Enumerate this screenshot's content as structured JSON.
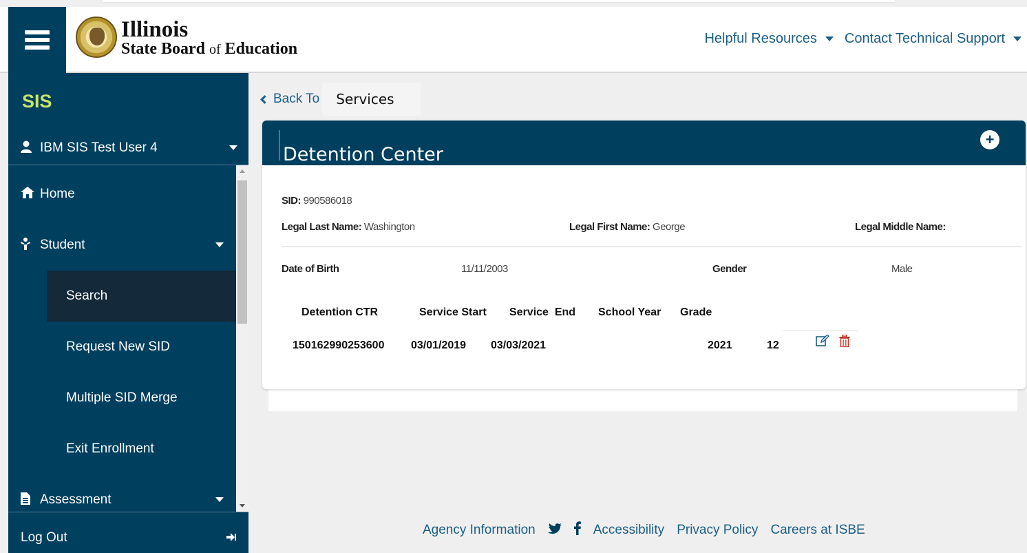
{
  "header": {
    "brand_line1": "Illinois",
    "brand_line2_a": "State Board",
    "brand_line2_of": "of",
    "brand_line2_b": "Education",
    "nav": [
      {
        "label": "Helpful Resources"
      },
      {
        "label": "Contact Technical Support"
      }
    ]
  },
  "sidebar": {
    "app_title": "SIS",
    "user_name": "IBM SIS Test User 4",
    "items": [
      {
        "label": "Home",
        "icon": "home-icon"
      },
      {
        "label": "Student",
        "icon": "student-icon"
      },
      {
        "label": "Search"
      },
      {
        "label": "Request New SID"
      },
      {
        "label": "Multiple SID Merge"
      },
      {
        "label": "Exit Enrollment"
      },
      {
        "label": "Assessment",
        "icon": "document-icon"
      }
    ],
    "logout_label": "Log Out"
  },
  "back": {
    "label": "Back To",
    "target": "Services"
  },
  "card": {
    "title": "Detention Center",
    "sid_label": "SID:",
    "sid_value": "990586018",
    "last_name_label": "Legal Last Name:",
    "last_name_value": "Washington",
    "first_name_label": "Legal First Name:",
    "first_name_value": "George",
    "middle_name_label": "Legal Middle Name:",
    "dob_label": "Date of Birth",
    "dob_value": "11/11/2003",
    "gender_label": "Gender",
    "gender_value": "Male",
    "table": {
      "headers": [
        "Detention CTR",
        "Service Start",
        "Service  End",
        "School Year",
        "Grade"
      ],
      "row": [
        "150162990253600",
        "03/01/2019",
        "03/03/2021",
        "2021",
        "12"
      ]
    }
  },
  "footer": {
    "links": [
      "Agency Information",
      "Accessibility",
      "Privacy Policy",
      "Careers at ISBE"
    ]
  },
  "colors": {
    "navy": "#003f5e",
    "sis_green": "#c8e36a",
    "link_blue": "#1b5f85",
    "delete_red": "#c0392b"
  }
}
